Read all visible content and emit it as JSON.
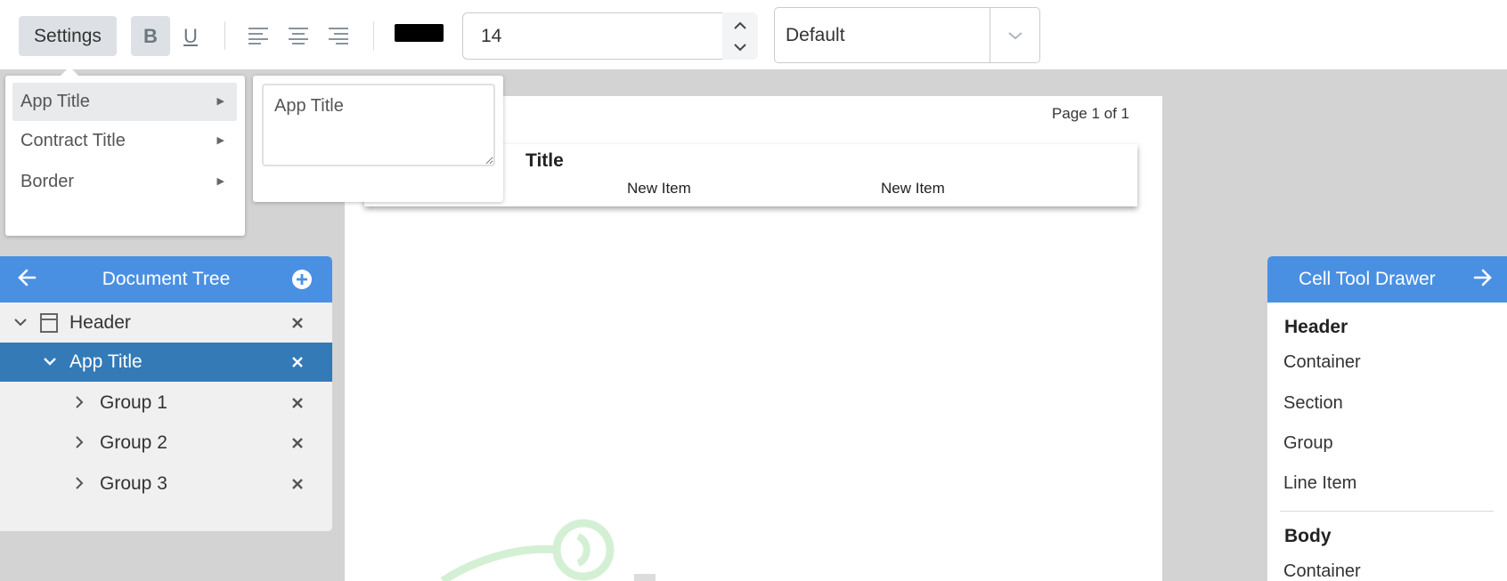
{
  "toolbar": {
    "settings_label": "Settings",
    "bold_label": "B",
    "underline_label": "U",
    "text_color": "#000000",
    "font_size_value": "14",
    "style_select_value": "Default"
  },
  "settings_menu": {
    "items": [
      {
        "label": "App Title"
      },
      {
        "label": "Contract Title"
      },
      {
        "label": "Border"
      }
    ],
    "submenu_text": "App Title"
  },
  "document": {
    "page_number": "Page 1 of 1",
    "header_title": "Title",
    "header_items": [
      "New Item",
      "New Item"
    ]
  },
  "document_tree": {
    "title": "Document Tree",
    "rows": [
      {
        "label": "Header"
      },
      {
        "label": "App Title"
      },
      {
        "label": "Group 1"
      },
      {
        "label": "Group 2"
      },
      {
        "label": "Group 3"
      }
    ]
  },
  "cell_tool_drawer": {
    "title": "Cell Tool Drawer",
    "sections": [
      {
        "title": "Header",
        "items": [
          "Container",
          "Section",
          "Group",
          "Line Item"
        ]
      },
      {
        "title": "Body",
        "items": [
          "Container"
        ]
      }
    ]
  },
  "colors": {
    "accent": "#4a90e2",
    "selected_row": "#337ab7",
    "watermark": "#d4f0d4"
  }
}
